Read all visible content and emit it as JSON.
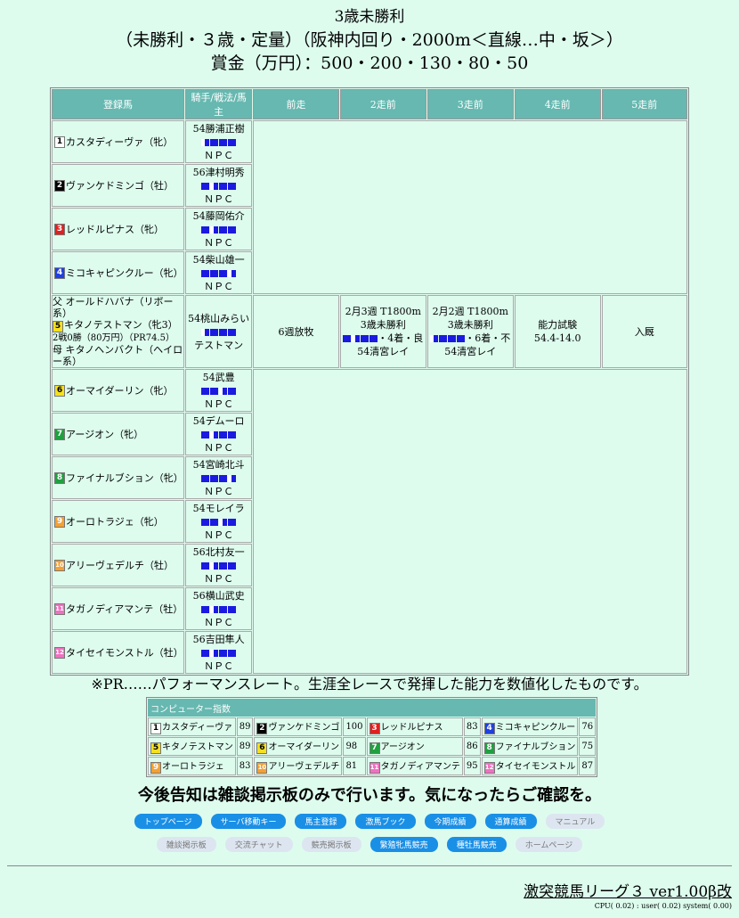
{
  "header": {
    "title": "3歳未勝利",
    "conditions": "（未勝利・３歳・定量）（阪神内回り・2000m＜直線…中・坂＞）",
    "prize": "賞金（万円）：500・200・130・80・50"
  },
  "table_headers": [
    "登録馬",
    "騎手/戦法/馬主",
    "前走",
    "2走前",
    "3走前",
    "4走前",
    "5走前"
  ],
  "horses": [
    {
      "num": "1",
      "name": "カスタディーヴァ（牝）",
      "jockey": "54勝浦正樹",
      "owner": "ＮＰＣ",
      "numColor": "#ffffff",
      "numText": "#000000"
    },
    {
      "num": "2",
      "name": "ヴァンケドミンゴ（牡）",
      "jockey": "56津村明秀",
      "owner": "ＮＰＣ",
      "numColor": "#000000",
      "numText": "#ffffff"
    },
    {
      "num": "3",
      "name": "レッドルピナス（牝）",
      "jockey": "54藤岡佑介",
      "owner": "ＮＰＣ",
      "numColor": "#e02020",
      "numText": "#ffffff"
    },
    {
      "num": "4",
      "name": "ミコキャピンクルー（牝）",
      "jockey": "54柴山雄一",
      "owner": "ＮＰＣ",
      "numColor": "#2040e0",
      "numText": "#ffffff"
    },
    {
      "num": "5",
      "name": "キタノテストマン（牝3）",
      "jockey": "54桃山みらい",
      "owner": "テストマン",
      "numColor": "#f5e020",
      "numText": "#000000",
      "sire": "父 オールドハバナ（リボー系）",
      "record": "2戦0勝（80万円）（PR74.5）",
      "dam": "母 キタノヘンバクト（ヘイロー系）",
      "races": [
        {
          "l1": "6週放牧",
          "l2": "",
          "l3": "",
          "l4": ""
        },
        {
          "l1": "2月3週 T1800m",
          "l2": "3歳未勝利",
          "l3": "・4着・良",
          "l4": "54清宮レイ"
        },
        {
          "l1": "2月2週 T1800m",
          "l2": "3歳未勝利",
          "l3": "・6着・不",
          "l4": "54清宮レイ"
        },
        {
          "l1": "能力試験",
          "l2": "54.4-14.0",
          "l3": "",
          "l4": ""
        },
        {
          "l1": "入厩",
          "l2": "",
          "l3": "",
          "l4": ""
        }
      ]
    },
    {
      "num": "6",
      "name": "オーマイダーリン（牝）",
      "jockey": "54武豊",
      "owner": "ＮＰＣ",
      "numColor": "#f5e020",
      "numText": "#000000"
    },
    {
      "num": "7",
      "name": "アージオン（牝）",
      "jockey": "54デムーロ",
      "owner": "ＮＰＣ",
      "numColor": "#20a040",
      "numText": "#ffffff"
    },
    {
      "num": "8",
      "name": "ファイナルブション（牝）",
      "jockey": "54宮崎北斗",
      "owner": "ＮＰＣ",
      "numColor": "#20a040",
      "numText": "#ffffff"
    },
    {
      "num": "9",
      "name": "オーロトラジェ（牝）",
      "jockey": "54モレイラ",
      "owner": "ＮＰＣ",
      "numColor": "#f5a030",
      "numText": "#ffffff"
    },
    {
      "num": "10",
      "name": "アリーヴェデルチ（牡）",
      "jockey": "56北村友一",
      "owner": "ＮＰＣ",
      "numColor": "#f5a030",
      "numText": "#ffffff"
    },
    {
      "num": "11",
      "name": "タガノディアマンテ（牡）",
      "jockey": "56横山武史",
      "owner": "ＮＰＣ",
      "numColor": "#f070c0",
      "numText": "#ffffff"
    },
    {
      "num": "12",
      "name": "タイセイモンストル（牡）",
      "jockey": "56吉田隼人",
      "owner": "ＮＰＣ",
      "numColor": "#f070c0",
      "numText": "#ffffff"
    }
  ],
  "note": "※PR……パフォーマンスレート。生涯全レースで発揮した能力を数値化したものです。",
  "computer_index": {
    "title": "コンピューター指数",
    "rows": [
      [
        {
          "num": "1",
          "name": "カスタディーヴァ",
          "score": "89",
          "c": "#ffffff",
          "t": "#000"
        },
        {
          "num": "2",
          "name": "ヴァンケドミンゴ",
          "score": "100",
          "c": "#000000",
          "t": "#fff"
        },
        {
          "num": "3",
          "name": "レッドルピナス",
          "score": "83",
          "c": "#e02020",
          "t": "#fff"
        },
        {
          "num": "4",
          "name": "ミコキャピンクルー",
          "score": "76",
          "c": "#2040e0",
          "t": "#fff"
        }
      ],
      [
        {
          "num": "5",
          "name": "キタノテストマン",
          "score": "89",
          "c": "#f5e020",
          "t": "#000"
        },
        {
          "num": "6",
          "name": "オーマイダーリン",
          "score": "98",
          "c": "#f5e020",
          "t": "#000"
        },
        {
          "num": "7",
          "name": "アージオン",
          "score": "86",
          "c": "#20a040",
          "t": "#fff"
        },
        {
          "num": "8",
          "name": "ファイナルブション",
          "score": "75",
          "c": "#20a040",
          "t": "#fff"
        }
      ],
      [
        {
          "num": "9",
          "name": "オーロトラジェ",
          "score": "83",
          "c": "#f5a030",
          "t": "#fff"
        },
        {
          "num": "10",
          "name": "アリーヴェデルチ",
          "score": "81",
          "c": "#f5a030",
          "t": "#fff"
        },
        {
          "num": "11",
          "name": "タガノディアマンテ",
          "score": "95",
          "c": "#f070c0",
          "t": "#fff"
        },
        {
          "num": "12",
          "name": "タイセイモンストル",
          "score": "87",
          "c": "#f070c0",
          "t": "#fff"
        }
      ]
    ]
  },
  "announce": "今後告知は雑談掲示板のみで行います。気になったらご確認を。",
  "buttons_row1": [
    {
      "label": "トップページ",
      "active": true
    },
    {
      "label": "サーバ移動キー",
      "active": true
    },
    {
      "label": "馬主登録",
      "active": true
    },
    {
      "label": "激馬ブック",
      "active": true
    },
    {
      "label": "今期成績",
      "active": true
    },
    {
      "label": "通算成績",
      "active": true
    },
    {
      "label": "マニュアル",
      "active": false
    }
  ],
  "buttons_row2": [
    {
      "label": "雑談掲示板",
      "active": false
    },
    {
      "label": "交流チャット",
      "active": false
    },
    {
      "label": "競売掲示板",
      "active": false
    },
    {
      "label": "繁殖牝馬競売",
      "active": true
    },
    {
      "label": "種牡馬競売",
      "active": true
    },
    {
      "label": "ホームページ",
      "active": false
    }
  ],
  "footer": {
    "version": "激突競馬リーグ３ ver1.00β改",
    "cpu": "CPU( 0.02) : user( 0.02) system( 0.00)"
  },
  "colors": {
    "background": "#ddfcee",
    "header_bg": "#66b8b0",
    "button": "#1a8fe6",
    "mark": "#1a1ae0"
  }
}
